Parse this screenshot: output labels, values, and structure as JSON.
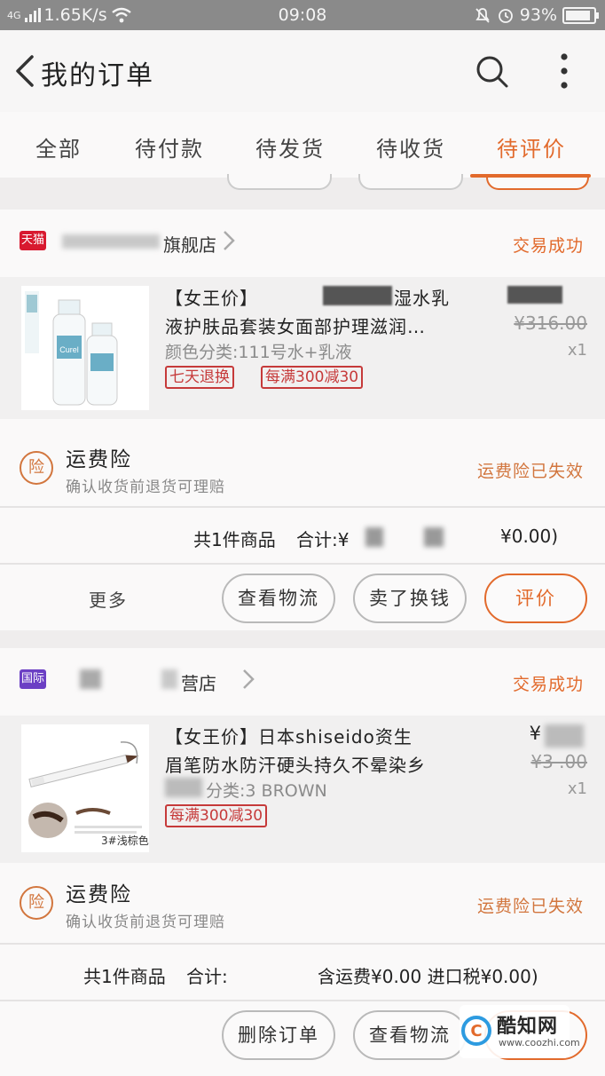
{
  "status_bar": {
    "network": "4G",
    "speed": "1.65K/s",
    "time": "09:08",
    "battery": "93%"
  },
  "header": {
    "title": "我的订单"
  },
  "tabs": [
    {
      "label": "全部",
      "active": false
    },
    {
      "label": "待付款",
      "active": false
    },
    {
      "label": "待发货",
      "active": false
    },
    {
      "label": "待收货",
      "active": false
    },
    {
      "label": "待评价",
      "active": true
    }
  ],
  "orders": [
    {
      "shop_badge": "天猫",
      "shop_name_fragment": "旗舰店",
      "status": "交易成功",
      "product": {
        "title_line1": "【女王价】",
        "title_line1_tail": "湿水乳",
        "title_line2": "液护肤品套装女面部护理滋润…",
        "attr": "颜色分类:111号水+乳液",
        "tags": [
          "七天退换",
          "每满300减30"
        ],
        "old_price": "¥316.00",
        "qty": "x1"
      },
      "insurance": {
        "icon": "险",
        "title": "运费险",
        "subtitle": "确认收货前退货可理赔",
        "status": "运费险已失效"
      },
      "summary": {
        "count_text": "共1件商品",
        "total_label": "合计:¥",
        "tail": "¥0.00)"
      },
      "actions": {
        "more": "更多",
        "buttons": [
          "查看物流",
          "卖了换钱",
          "评价"
        ]
      }
    },
    {
      "shop_badge": "国际",
      "shop_name_fragment": "营店",
      "status": "交易成功",
      "product": {
        "title_line1": "【女王价】日本shiseido资生",
        "title_line2": "眉笔防水防汗硬头持久不晕染乡",
        "attr": "分类:3 BROWN",
        "tags": [
          "每满300减30"
        ],
        "price": "¥",
        "old_price": "¥3 .00",
        "qty": "x1",
        "thumb_caption": "3#浅棕色"
      },
      "insurance": {
        "icon": "险",
        "title": "运费险",
        "subtitle": "确认收货前退货可理赔",
        "status": "运费险已失效"
      },
      "summary": {
        "count_text": "共1件商品",
        "total_label": "合计:",
        "tail": "含运费¥0.00 进口税¥0.00)"
      },
      "actions": {
        "buttons": [
          "删除订单",
          "查看物流"
        ]
      }
    }
  ],
  "watermark": {
    "name": "酷知网",
    "url": "www.coozhi.com",
    "logo_letter": "C"
  },
  "colors": {
    "accent": "#e26a2c",
    "tag_red": "#c63a3a",
    "tmall_red": "#d8192f",
    "intl_purple": "#6b3fc4"
  }
}
